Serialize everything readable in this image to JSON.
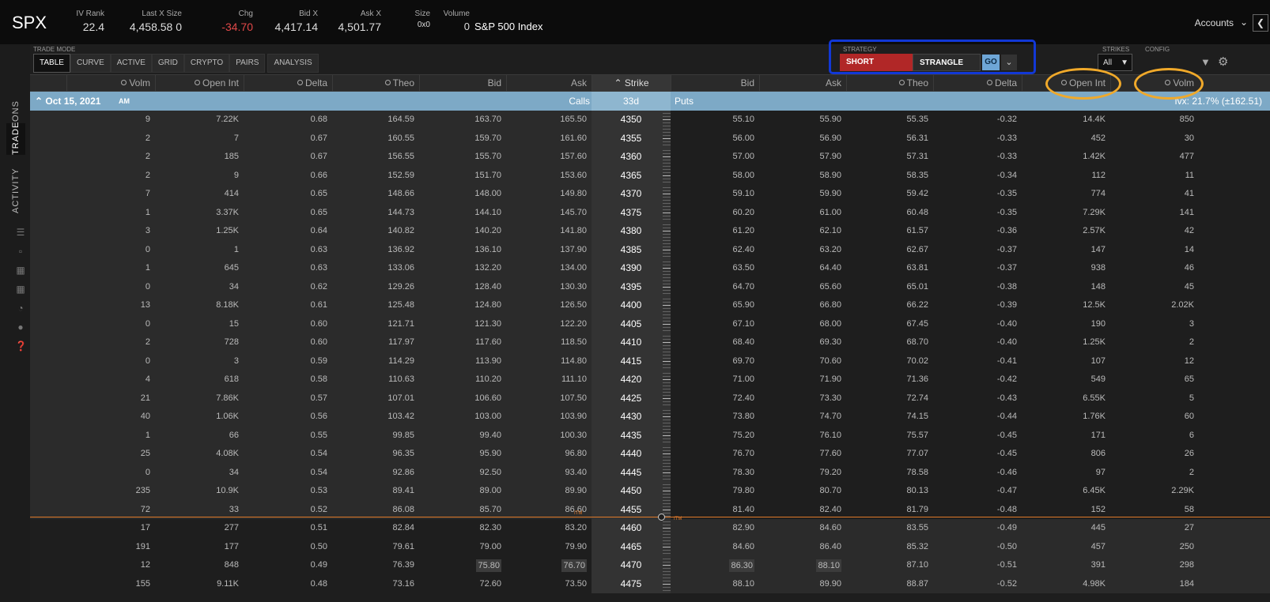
{
  "header": {
    "symbol": "SPX",
    "quotes": [
      {
        "label": "IV Rank",
        "value": "22.4"
      },
      {
        "label": "Last X Size",
        "value": "4,458.58 0"
      },
      {
        "label": "Chg",
        "value": "-34.70"
      },
      {
        "label": "Bid X",
        "value": "4,417.14"
      },
      {
        "label": "Ask X",
        "value": "4,501.77"
      },
      {
        "label": "Size",
        "value": "0x0"
      },
      {
        "label": "Volume",
        "value": "0"
      }
    ],
    "index_name": "S&P 500 Index",
    "accounts_label": "Accounts"
  },
  "left_nav": {
    "tabs": [
      "POSITIONS",
      "TRADE",
      "ACTIVITY"
    ]
  },
  "trade_mode": {
    "label": "TRADE MODE",
    "modes": [
      "TABLE",
      "CURVE",
      "ACTIVE",
      "GRID",
      "CRYPTO",
      "PAIRS",
      "ANALYSIS"
    ]
  },
  "strategy": {
    "label": "STRATEGY",
    "side": "SHORT",
    "type": "STRANGLE",
    "go": "GO"
  },
  "strikes": {
    "label": "STRIKES",
    "value": "All"
  },
  "config": {
    "label": "CONFIG"
  },
  "columns": {
    "calls": [
      "Volm",
      "Open Int",
      "Delta",
      "Theo",
      "Bid",
      "Ask"
    ],
    "strike": "Strike",
    "puts": [
      "Bid",
      "Ask",
      "Theo",
      "Delta",
      "Open Int",
      "Volm"
    ]
  },
  "expiration": {
    "date": "Oct 15, 2021",
    "session": "AM",
    "calls_label": "Calls",
    "dte": "33d",
    "puts_label": "Puts",
    "ivx": "Ivx: 21.7% (±162.51)"
  },
  "itm_label": "ITM",
  "rows": [
    [
      "9",
      "7.22K",
      "0.68",
      "164.59",
      "163.70",
      "165.50",
      "4350",
      "55.10",
      "55.90",
      "55.35",
      "-0.32",
      "14.4K",
      "850"
    ],
    [
      "2",
      "7",
      "0.67",
      "160.55",
      "159.70",
      "161.60",
      "4355",
      "56.00",
      "56.90",
      "56.31",
      "-0.33",
      "452",
      "30"
    ],
    [
      "2",
      "185",
      "0.67",
      "156.55",
      "155.70",
      "157.60",
      "4360",
      "57.00",
      "57.90",
      "57.31",
      "-0.33",
      "1.42K",
      "477"
    ],
    [
      "2",
      "9",
      "0.66",
      "152.59",
      "151.70",
      "153.60",
      "4365",
      "58.00",
      "58.90",
      "58.35",
      "-0.34",
      "112",
      "11"
    ],
    [
      "7",
      "414",
      "0.65",
      "148.66",
      "148.00",
      "149.80",
      "4370",
      "59.10",
      "59.90",
      "59.42",
      "-0.35",
      "774",
      "41"
    ],
    [
      "1",
      "3.37K",
      "0.65",
      "144.73",
      "144.10",
      "145.70",
      "4375",
      "60.20",
      "61.00",
      "60.48",
      "-0.35",
      "7.29K",
      "141"
    ],
    [
      "3",
      "1.25K",
      "0.64",
      "140.82",
      "140.20",
      "141.80",
      "4380",
      "61.20",
      "62.10",
      "61.57",
      "-0.36",
      "2.57K",
      "42"
    ],
    [
      "0",
      "1",
      "0.63",
      "136.92",
      "136.10",
      "137.90",
      "4385",
      "62.40",
      "63.20",
      "62.67",
      "-0.37",
      "147",
      "14"
    ],
    [
      "1",
      "645",
      "0.63",
      "133.06",
      "132.20",
      "134.00",
      "4390",
      "63.50",
      "64.40",
      "63.81",
      "-0.37",
      "938",
      "46"
    ],
    [
      "0",
      "34",
      "0.62",
      "129.26",
      "128.40",
      "130.30",
      "4395",
      "64.70",
      "65.60",
      "65.01",
      "-0.38",
      "148",
      "45"
    ],
    [
      "13",
      "8.18K",
      "0.61",
      "125.48",
      "124.80",
      "126.50",
      "4400",
      "65.90",
      "66.80",
      "66.22",
      "-0.39",
      "12.5K",
      "2.02K"
    ],
    [
      "0",
      "15",
      "0.60",
      "121.71",
      "121.30",
      "122.20",
      "4405",
      "67.10",
      "68.00",
      "67.45",
      "-0.40",
      "190",
      "3"
    ],
    [
      "2",
      "728",
      "0.60",
      "117.97",
      "117.60",
      "118.50",
      "4410",
      "68.40",
      "69.30",
      "68.70",
      "-0.40",
      "1.25K",
      "2"
    ],
    [
      "0",
      "3",
      "0.59",
      "114.29",
      "113.90",
      "114.80",
      "4415",
      "69.70",
      "70.60",
      "70.02",
      "-0.41",
      "107",
      "12"
    ],
    [
      "4",
      "618",
      "0.58",
      "110.63",
      "110.20",
      "111.10",
      "4420",
      "71.00",
      "71.90",
      "71.36",
      "-0.42",
      "549",
      "65"
    ],
    [
      "21",
      "7.86K",
      "0.57",
      "107.01",
      "106.60",
      "107.50",
      "4425",
      "72.40",
      "73.30",
      "72.74",
      "-0.43",
      "6.55K",
      "5"
    ],
    [
      "40",
      "1.06K",
      "0.56",
      "103.42",
      "103.00",
      "103.90",
      "4430",
      "73.80",
      "74.70",
      "74.15",
      "-0.44",
      "1.76K",
      "60"
    ],
    [
      "1",
      "66",
      "0.55",
      "99.85",
      "99.40",
      "100.30",
      "4435",
      "75.20",
      "76.10",
      "75.57",
      "-0.45",
      "171",
      "6"
    ],
    [
      "25",
      "4.08K",
      "0.54",
      "96.35",
      "95.90",
      "96.80",
      "4440",
      "76.70",
      "77.60",
      "77.07",
      "-0.45",
      "806",
      "26"
    ],
    [
      "0",
      "34",
      "0.54",
      "92.86",
      "92.50",
      "93.40",
      "4445",
      "78.30",
      "79.20",
      "78.58",
      "-0.46",
      "97",
      "2"
    ],
    [
      "235",
      "10.9K",
      "0.53",
      "89.41",
      "89.00",
      "89.90",
      "4450",
      "79.80",
      "80.70",
      "80.13",
      "-0.47",
      "6.45K",
      "2.29K"
    ],
    [
      "72",
      "33",
      "0.52",
      "86.08",
      "85.70",
      "86.60",
      "4455",
      "81.40",
      "82.40",
      "81.79",
      "-0.48",
      "152",
      "58"
    ],
    [
      "17",
      "277",
      "0.51",
      "82.84",
      "82.30",
      "83.20",
      "4460",
      "82.90",
      "84.60",
      "83.55",
      "-0.49",
      "445",
      "27"
    ],
    [
      "191",
      "177",
      "0.50",
      "79.61",
      "79.00",
      "79.90",
      "4465",
      "84.60",
      "86.40",
      "85.32",
      "-0.50",
      "457",
      "250"
    ],
    [
      "12",
      "848",
      "0.49",
      "76.39",
      "75.80",
      "76.70",
      "4470",
      "86.30",
      "88.10",
      "87.10",
      "-0.51",
      "391",
      "298"
    ],
    [
      "155",
      "9.11K",
      "0.48",
      "73.16",
      "72.60",
      "73.50",
      "4475",
      "88.10",
      "89.90",
      "88.87",
      "-0.52",
      "4.98K",
      "184"
    ]
  ],
  "colors": {
    "accent_blue": "#7da9c6",
    "short_red": "#b12727",
    "money_line": "#e07a2a",
    "annotation_blue": "#1238d6",
    "annotation_orange": "#f0a92a"
  }
}
